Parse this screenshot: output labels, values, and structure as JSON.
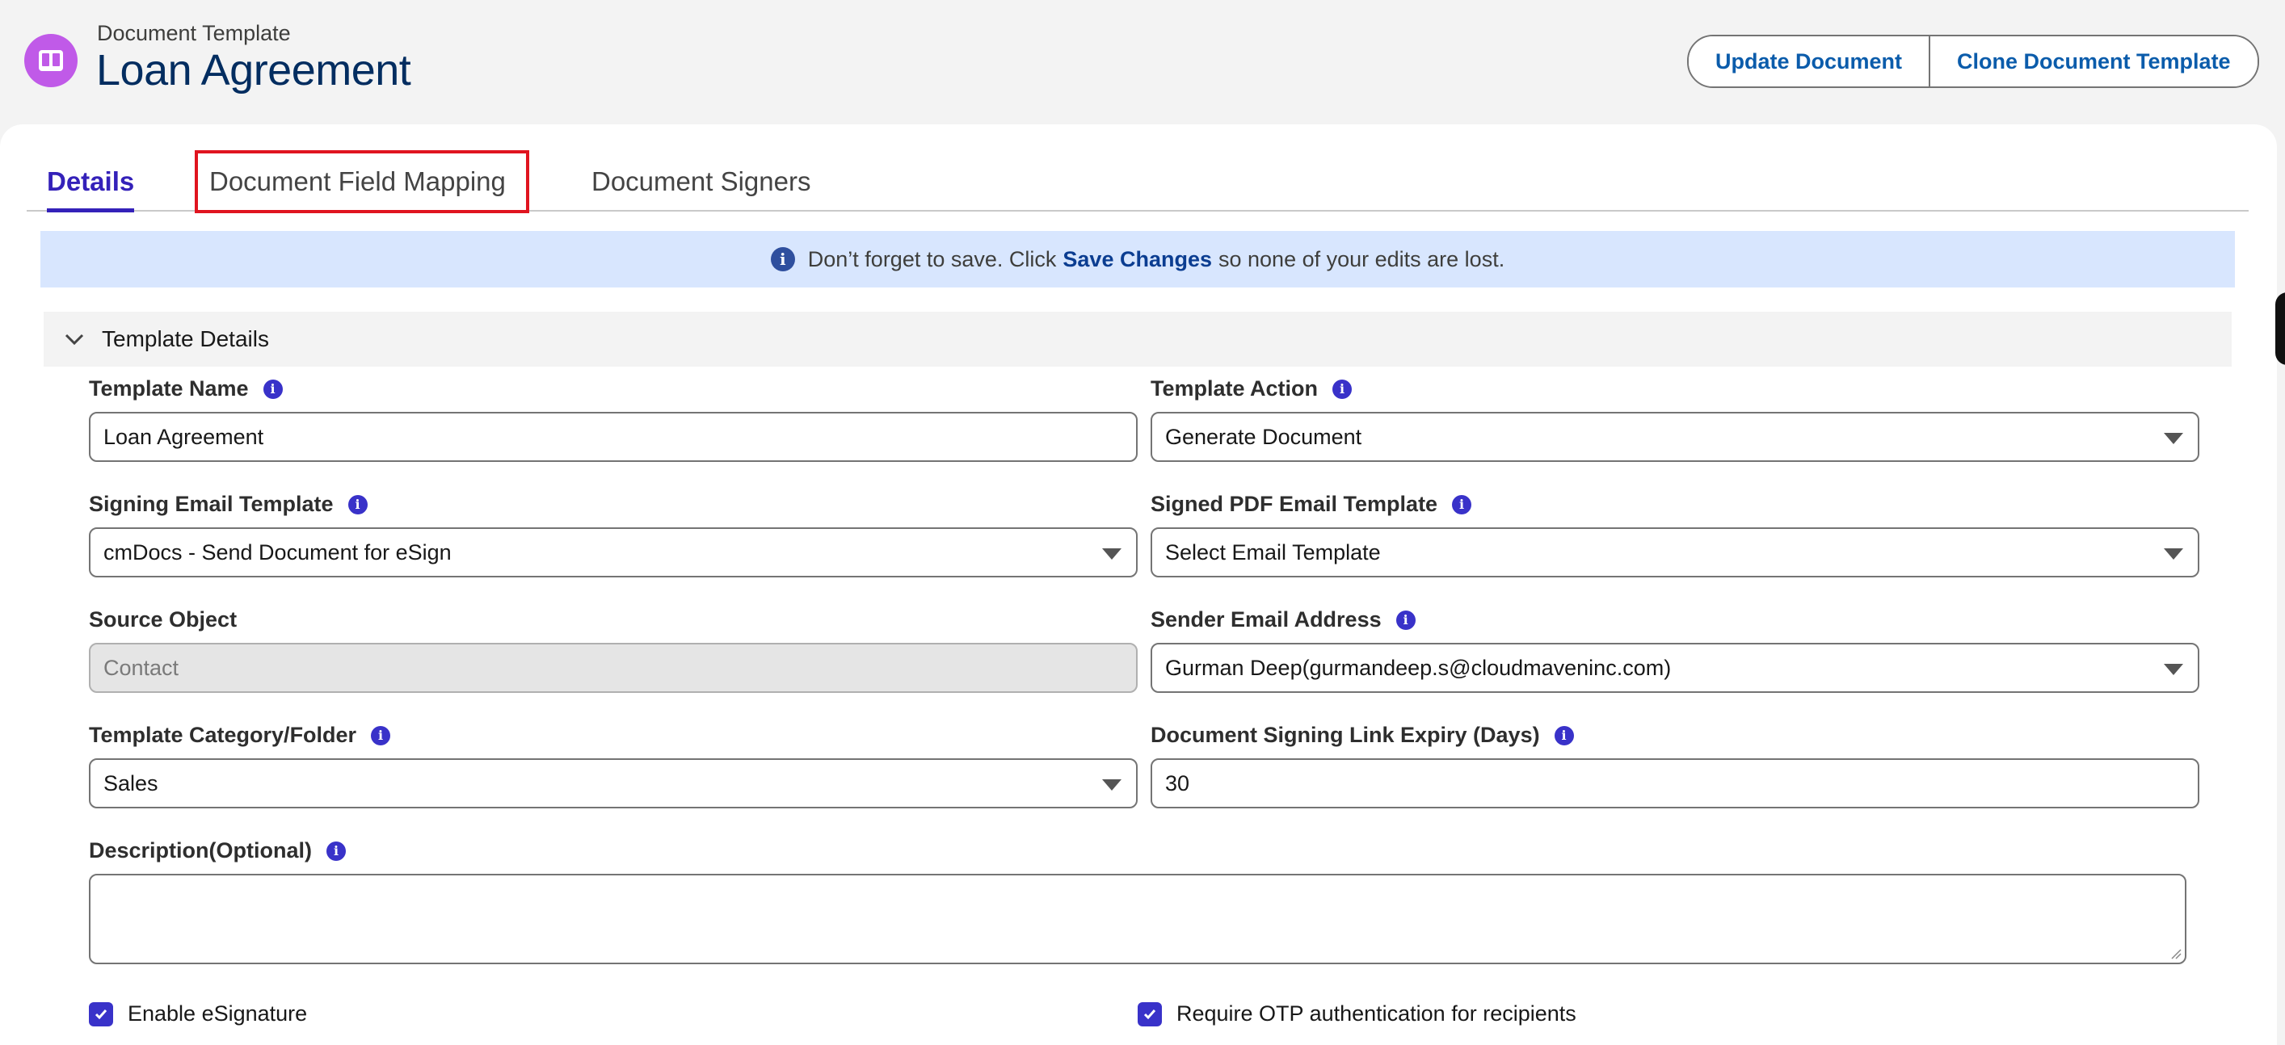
{
  "header": {
    "object_label": "Document Template",
    "record_title": "Loan Agreement",
    "icon": "book-icon",
    "icon_color": "#c05ae8",
    "actions": [
      "Update Document",
      "Clone Document Template"
    ]
  },
  "tabs": [
    {
      "label": "Details",
      "active": true
    },
    {
      "label": "Document Field Mapping",
      "highlighted": true
    },
    {
      "label": "Document Signers"
    }
  ],
  "banner": {
    "prefix": "Don’t forget to save. Click",
    "bold": "Save Changes",
    "suffix": "so none of your edits are lost."
  },
  "section": {
    "title": "Template Details",
    "expanded": true
  },
  "fields": {
    "template_name": {
      "label": "Template Name",
      "value": "Loan Agreement"
    },
    "template_action": {
      "label": "Template Action",
      "value": "Generate Document"
    },
    "signing_email_template": {
      "label": "Signing Email Template",
      "value": "cmDocs - Send Document for eSign"
    },
    "signed_pdf_email_template": {
      "label": "Signed PDF Email Template",
      "value": "Select Email Template"
    },
    "source_object": {
      "label": "Source Object",
      "value": "Contact"
    },
    "sender_email_address": {
      "label": "Sender Email Address",
      "value": "Gurman Deep(gurmandeep.s@cloudmaveninc.com)"
    },
    "template_category": {
      "label": "Template Category/Folder",
      "value": "Sales"
    },
    "signing_link_expiry": {
      "label": "Document Signing Link Expiry (Days)",
      "value": "30"
    },
    "description": {
      "label": "Description(Optional)",
      "value": ""
    }
  },
  "checkboxes": {
    "enable_esignature": {
      "label": "Enable eSignature",
      "checked": true
    },
    "require_otp": {
      "label": "Require OTP authentication for recipients",
      "checked": true
    }
  },
  "colors": {
    "accent": "#3421b9",
    "link": "#0b5cab",
    "banner_bg": "#d8e6fe",
    "highlight": "#e0141f"
  }
}
